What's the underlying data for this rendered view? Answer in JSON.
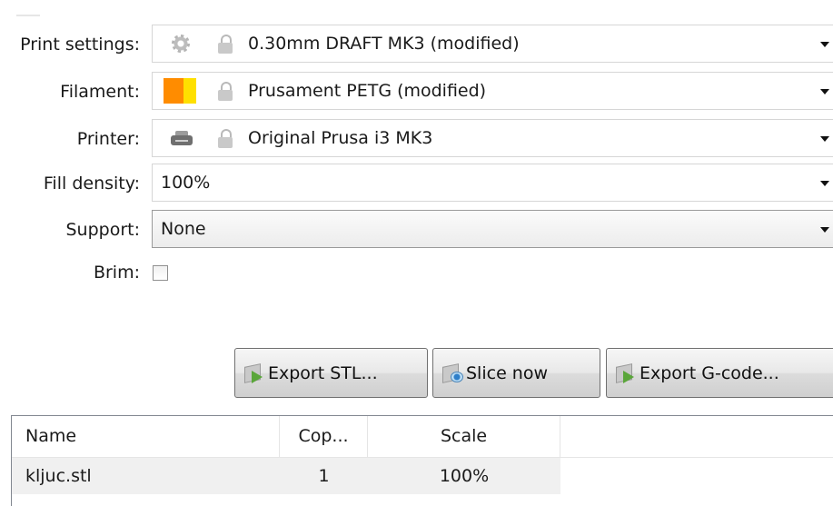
{
  "settings": {
    "print_settings": {
      "label": "Print settings:",
      "value": "0.30mm DRAFT MK3 (modified)",
      "icon": "gear-icon"
    },
    "filament": {
      "label": "Filament:",
      "value": "Prusament PETG (modified)",
      "swatch_colors": [
        "#ff8c00",
        "#ffe000"
      ]
    },
    "printer": {
      "label": "Printer:",
      "value": "Original Prusa i3 MK3",
      "icon": "printer-icon"
    },
    "fill_density": {
      "label": "Fill density:",
      "value": "100%"
    },
    "support": {
      "label": "Support:",
      "value": "None"
    },
    "brim": {
      "label": "Brim:",
      "checked": false
    }
  },
  "actions": {
    "export_stl": "Export STL...",
    "slice_now": "Slice now",
    "export_gcode": "Export G-code..."
  },
  "object_list": {
    "columns": [
      "Name",
      "Cop...",
      "Scale"
    ],
    "rows": [
      {
        "name": "kljuc.stl",
        "copies": "1",
        "scale": "100%"
      }
    ]
  }
}
